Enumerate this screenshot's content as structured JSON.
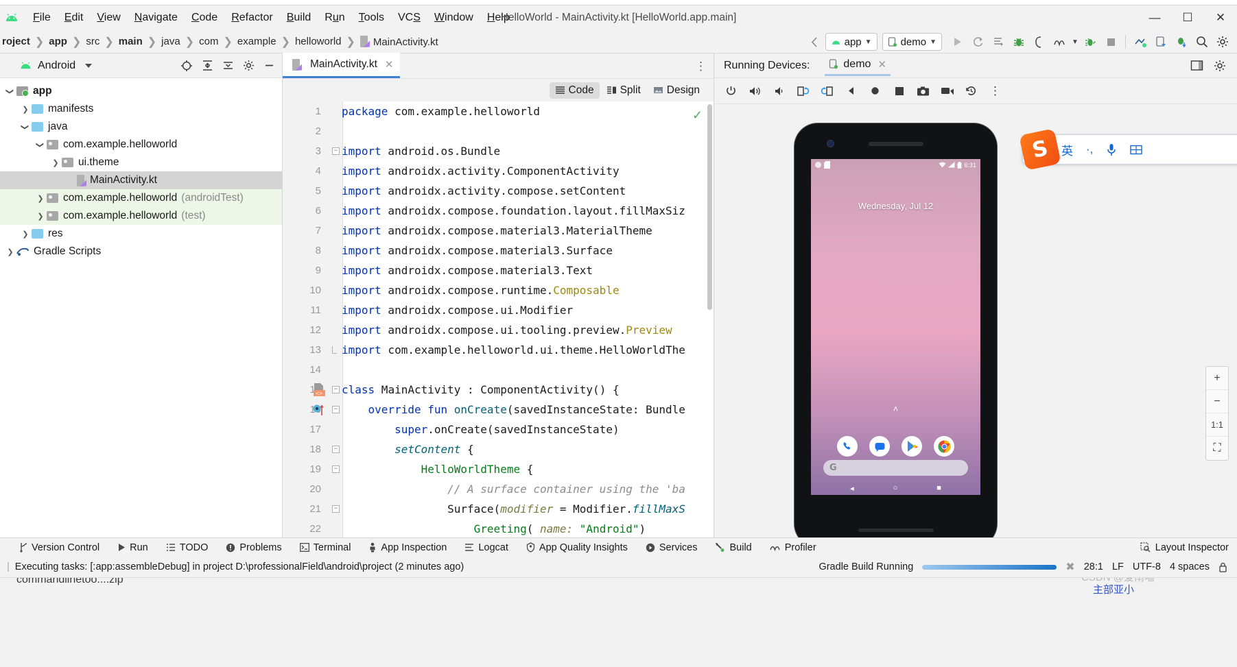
{
  "window": {
    "title": "HelloWorld - MainActivity.kt [HelloWorld.app.main]",
    "minimize": "—",
    "maximize": "☐",
    "close": "✕"
  },
  "menubar": {
    "logo_name": "android-logo-icon",
    "items": [
      "File",
      "Edit",
      "View",
      "Navigate",
      "Code",
      "Refactor",
      "Build",
      "Run",
      "Tools",
      "VCS",
      "Window",
      "Help"
    ]
  },
  "breadcrumbs": [
    {
      "label": "roject",
      "bold": true
    },
    {
      "label": "app",
      "bold": true
    },
    {
      "label": "src",
      "bold": false
    },
    {
      "label": "main",
      "bold": true
    },
    {
      "label": "java",
      "bold": false
    },
    {
      "label": "com",
      "bold": false
    },
    {
      "label": "example",
      "bold": false
    },
    {
      "label": "helloworld",
      "bold": false
    },
    {
      "label": "MainActivity.kt",
      "bold": false,
      "icon": "kotlin-file-icon"
    }
  ],
  "toolbar": {
    "module_selector": "app",
    "device_selector": "demo",
    "run_label": "Run",
    "icons": [
      "back-icon",
      "run-icon",
      "rerun-icon",
      "run-with-coverage-icon",
      "debug-icon",
      "attach-debugger-icon",
      "profiler-icon",
      "dropdown-icon",
      "apply-changes-icon",
      "stop-icon",
      "device-manager-icon",
      "device-file-explorer-icon",
      "sdk-manager-icon",
      "search-icon",
      "settings-icon"
    ]
  },
  "project_panel": {
    "title": "Android",
    "title_icon": "android-head-icon",
    "tools": [
      "select-opened-file-icon",
      "expand-all-icon",
      "collapse-all-icon",
      "settings-icon",
      "hide-icon"
    ],
    "tree": [
      {
        "depth": 0,
        "arrow": "down",
        "icon": "module-folder",
        "label": "app",
        "bold": true,
        "dim": "",
        "state": "normal"
      },
      {
        "depth": 1,
        "arrow": "right",
        "icon": "blue-folder",
        "label": "manifests",
        "bold": false,
        "dim": "",
        "state": "normal"
      },
      {
        "depth": 1,
        "arrow": "down",
        "icon": "blue-folder",
        "label": "java",
        "bold": false,
        "dim": "",
        "state": "normal"
      },
      {
        "depth": 2,
        "arrow": "down",
        "icon": "package-folder",
        "label": "com.example.helloworld",
        "bold": false,
        "dim": "",
        "state": "normal"
      },
      {
        "depth": 3,
        "arrow": "right",
        "icon": "package-folder",
        "label": "ui.theme",
        "bold": false,
        "dim": "",
        "state": "normal"
      },
      {
        "depth": 4,
        "arrow": "none",
        "icon": "kotlin-file",
        "label": "MainActivity.kt",
        "bold": false,
        "dim": "",
        "state": "selected"
      },
      {
        "depth": 2,
        "arrow": "right",
        "icon": "package-folder",
        "label": "com.example.helloworld",
        "bold": false,
        "dim": "(androidTest)",
        "state": "green"
      },
      {
        "depth": 2,
        "arrow": "right",
        "icon": "package-folder",
        "label": "com.example.helloworld",
        "bold": false,
        "dim": "(test)",
        "state": "green"
      },
      {
        "depth": 1,
        "arrow": "right",
        "icon": "res-folder",
        "label": "res",
        "bold": false,
        "dim": "",
        "state": "normal"
      },
      {
        "depth": 0,
        "arrow": "right",
        "icon": "gradle-icon",
        "label": "Gradle Scripts",
        "bold": false,
        "dim": "",
        "state": "normal"
      }
    ]
  },
  "editor": {
    "tab": {
      "label": "MainActivity.kt",
      "icon": "kotlin-file-icon",
      "close": "✕"
    },
    "more_icon": "more-options-icon",
    "view_modes": [
      {
        "label": "Code",
        "icon": "code-view-icon",
        "active": true
      },
      {
        "label": "Split",
        "icon": "split-view-icon",
        "active": false
      },
      {
        "label": "Design",
        "icon": "design-view-icon",
        "active": false
      }
    ],
    "inspection_status": "✓",
    "lines": [
      {
        "n": "1",
        "html": "<span class='kw'>package</span> com.example.helloworld"
      },
      {
        "n": "2",
        "html": ""
      },
      {
        "n": "3",
        "html": "<span class='kw'>import</span> android.os.Bundle",
        "fold": "minus"
      },
      {
        "n": "4",
        "html": "<span class='kw'>import</span> androidx.activity.ComponentActivity"
      },
      {
        "n": "5",
        "html": "<span class='kw'>import</span> androidx.activity.compose.setContent"
      },
      {
        "n": "6",
        "html": "<span class='kw'>import</span> androidx.compose.foundation.layout.fillMaxSiz"
      },
      {
        "n": "7",
        "html": "<span class='kw'>import</span> androidx.compose.material3.MaterialTheme"
      },
      {
        "n": "8",
        "html": "<span class='kw'>import</span> androidx.compose.material3.Surface"
      },
      {
        "n": "9",
        "html": "<span class='kw'>import</span> androidx.compose.material3.Text"
      },
      {
        "n": "10",
        "html": "<span class='kw'>import</span> androidx.compose.runtime.<span class='ann'>Composable</span>"
      },
      {
        "n": "11",
        "html": "<span class='kw'>import</span> androidx.compose.ui.Modifier"
      },
      {
        "n": "12",
        "html": "<span class='kw'>import</span> androidx.compose.ui.tooling.preview.<span class='ann'>Preview</span>"
      },
      {
        "n": "13",
        "html": "<span class='kw'>import</span> com.example.helloworld.ui.theme.HelloWorldThe",
        "fold": "end"
      },
      {
        "n": "14",
        "html": ""
      },
      {
        "n": "15",
        "html": "<span class='kw'>class</span> MainActivity : ComponentActivity() {",
        "fold": "minus",
        "marker": "class-marker"
      },
      {
        "n": "16",
        "html": "    <span class='kw'>override fun</span> <span class='fn'>onCreate</span>(savedInstanceState: Bundle",
        "fold": "minus",
        "marker": "override-marker"
      },
      {
        "n": "17",
        "html": "        <span class='kw'>super</span>.onCreate(savedInstanceState)"
      },
      {
        "n": "18",
        "html": "        <span class='fnn'>setContent</span> {",
        "fold": "minus"
      },
      {
        "n": "19",
        "html": "            <span class='grn'>HelloWorldTheme</span> {",
        "fold": "minus"
      },
      {
        "n": "20",
        "html": "                <span class='cmt'>// A surface container using the 'ba</span>"
      },
      {
        "n": "21",
        "html": "                Surface(<span class='prm'>modifier</span> = Modifier.<span class='fnn'>fillMaxS</span>",
        "fold": "minus"
      },
      {
        "n": "22",
        "html": "                    <span class='grn'>Greeting</span>( <span class='prm'>name:</span> <span class='str'>\"Android\"</span>)"
      }
    ]
  },
  "running_devices": {
    "label": "Running Devices:",
    "tab": {
      "label": "demo",
      "icon": "device-icon",
      "close": "✕"
    },
    "header_tools": [
      "split-window-icon",
      "settings-icon"
    ],
    "toolbar_icons": [
      "power-icon",
      "volume-up-icon",
      "volume-down-icon",
      "rotate-left-icon",
      "rotate-right-icon",
      "back-icon",
      "home-icon",
      "overview-icon",
      "screenshot-icon",
      "record-icon",
      "history-icon",
      "more-icon"
    ],
    "emulator": {
      "date": "Wednesday, Jul 12",
      "clock": "6:31",
      "status_icons": [
        "wifi-icon",
        "signal-icon",
        "battery-icon"
      ],
      "notification_icons": [
        "circle-notification-icon",
        "sdcard-icon"
      ],
      "dock_apps": [
        "phone-icon",
        "messages-icon",
        "play-store-icon",
        "chrome-icon"
      ],
      "search_placeholder": "",
      "search_icon": "google-g-icon",
      "nav_keys": [
        "back-icon",
        "home-icon",
        "recents-icon"
      ],
      "up_chevron": "˄"
    },
    "zoom_controls": [
      {
        "label": "+",
        "name": "zoom-in-button"
      },
      {
        "label": "−",
        "name": "zoom-out-button"
      },
      {
        "label": "1:1",
        "name": "zoom-actual-button"
      },
      {
        "label": "⛶",
        "name": "zoom-fit-button"
      }
    ]
  },
  "ime_bar": {
    "logo": "S",
    "items": [
      "英",
      "·,",
      "microphone-icon",
      "keyboard-icon"
    ]
  },
  "bottom_tool_windows": [
    {
      "label": "Version Control",
      "icon": "vcs-icon"
    },
    {
      "label": "Run",
      "icon": "run-icon"
    },
    {
      "label": "TODO",
      "icon": "todo-icon"
    },
    {
      "label": "Problems",
      "icon": "problems-icon"
    },
    {
      "label": "Terminal",
      "icon": "terminal-icon"
    },
    {
      "label": "App Inspection",
      "icon": "app-inspection-icon"
    },
    {
      "label": "Logcat",
      "icon": "logcat-icon"
    },
    {
      "label": "App Quality Insights",
      "icon": "app-quality-icon"
    },
    {
      "label": "Services",
      "icon": "services-icon"
    },
    {
      "label": "Build",
      "icon": "build-icon"
    },
    {
      "label": "Profiler",
      "icon": "profiler-icon"
    }
  ],
  "bottom_right_tool": {
    "label": "Layout Inspector",
    "icon": "layout-inspector-icon"
  },
  "status_bar": {
    "message": "Executing tasks: [:app:assembleDebug] in project D:\\professionalField\\android\\project (2 minutes ago)",
    "build_status": "Gradle Build Running",
    "cancel_icon": "cancel-icon",
    "caret": "28:1",
    "line_separator": "LF",
    "encoding": "UTF-8",
    "indent": "4 spaces",
    "lock_icon": "lock-icon"
  },
  "taskbar": {
    "download_chip": "commandlinetoo....zip",
    "watermark": "CSDN @爱南墙",
    "watermark2": "主部亚小"
  },
  "colors": {
    "accent": "#3b82d6",
    "keyword": "#0033b3",
    "string": "#067d17",
    "comment": "#8c8c8c",
    "annotation": "#9e880d",
    "green": "#4caf50"
  }
}
